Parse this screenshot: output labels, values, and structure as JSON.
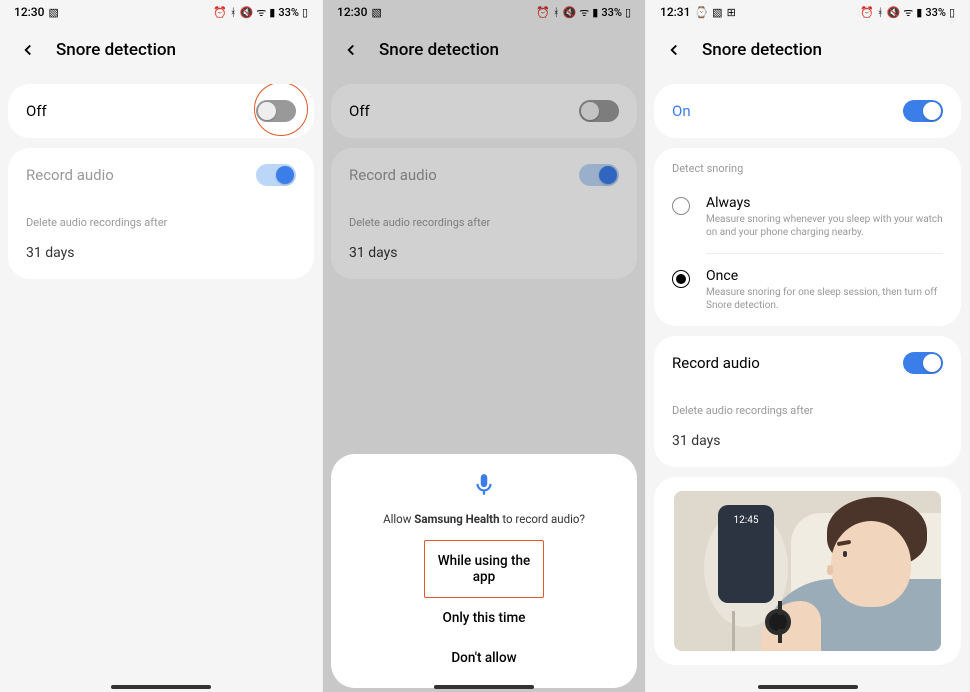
{
  "colors": {
    "accent": "#3b7de9",
    "highlight": "#e05a2b"
  },
  "screens": [
    {
      "status": {
        "time": "12:30",
        "left_icons": [
          "image-icon"
        ],
        "right_icons": [
          "alarm-icon",
          "bluetooth-icon",
          "mute-icon",
          "wifi-icon",
          "signal-icon"
        ],
        "battery": "33%"
      },
      "title": "Snore detection",
      "main_toggle": {
        "label": "Off",
        "on": false,
        "highlighted": true
      },
      "record_audio": {
        "label": "Record audio",
        "on": true,
        "disabled": true
      },
      "delete_label": "Delete audio recordings after",
      "delete_value": "31 days"
    },
    {
      "status": {
        "time": "12:30",
        "left_icons": [
          "image-icon"
        ],
        "right_icons": [
          "alarm-icon",
          "bluetooth-icon",
          "mute-icon",
          "wifi-icon",
          "signal-icon"
        ],
        "battery": "33%"
      },
      "title": "Snore detection",
      "main_toggle": {
        "label": "Off",
        "on": false,
        "highlighted": false
      },
      "record_audio": {
        "label": "Record audio",
        "on": true,
        "disabled": true
      },
      "delete_label": "Delete audio recordings after",
      "delete_value": "31 days",
      "dialog": {
        "prompt_pre": "Allow ",
        "prompt_app": "Samsung Health",
        "prompt_post": " to record audio?",
        "options": [
          "While using the app",
          "Only this time",
          "Don't allow"
        ],
        "highlighted_index": 0
      }
    },
    {
      "status": {
        "time": "12:31",
        "left_icons": [
          "watch-icon",
          "image-icon",
          "grid-icon"
        ],
        "right_icons": [
          "alarm-icon",
          "bluetooth-icon",
          "mute-icon",
          "wifi-icon",
          "signal-icon"
        ],
        "battery": "33%"
      },
      "title": "Snore detection",
      "main_toggle": {
        "label": "On",
        "on": true,
        "highlighted": false
      },
      "section_label": "Detect snoring",
      "options": [
        {
          "title": "Always",
          "desc": "Measure snoring whenever you sleep with your watch on and your phone charging nearby.",
          "selected": false
        },
        {
          "title": "Once",
          "desc": "Measure snoring for one sleep session, then turn off Snore detection.",
          "selected": true
        }
      ],
      "record_audio": {
        "label": "Record audio",
        "on": true,
        "disabled": false
      },
      "delete_label": "Delete audio recordings after",
      "delete_value": "31 days",
      "illustration_phone_time": "12:45"
    }
  ]
}
